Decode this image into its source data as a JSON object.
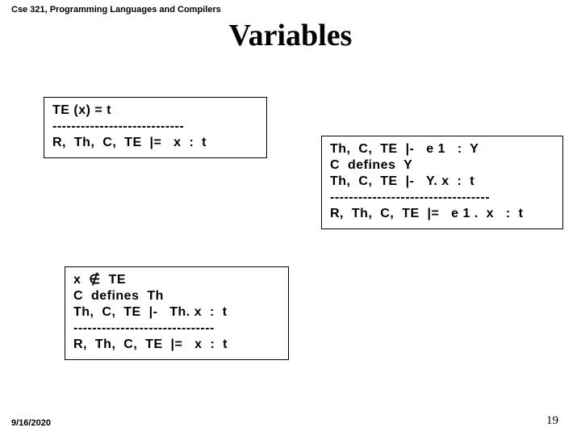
{
  "header": "Cse 321, Programming Languages and Compilers",
  "title": "Variables",
  "rule1": {
    "l1": "TE (x) = t",
    "l2": "----------------------------",
    "l3": "R,  Th,  C,  TE  |=   x  :  t"
  },
  "rule2": {
    "l1": "Th,  C,  TE  |-   e 1   :  Y",
    "l2": "C  defines  Y",
    "l3": "Th,  C,  TE  |-   Y. x  :  t",
    "l4": "----------------------------------",
    "l5": "R,  Th,  C,  TE  |=   e 1 .  x   :  t"
  },
  "rule3": {
    "l1": "x  ∉  TE",
    "l2": "C  defines  Th",
    "l3": "Th,  C,  TE  |-   Th. x  :  t",
    "l4": "------------------------------",
    "l5": "R,  Th,  C,  TE  |=   x  :  t"
  },
  "footer": {
    "date": "9/16/2020",
    "page": "19"
  }
}
